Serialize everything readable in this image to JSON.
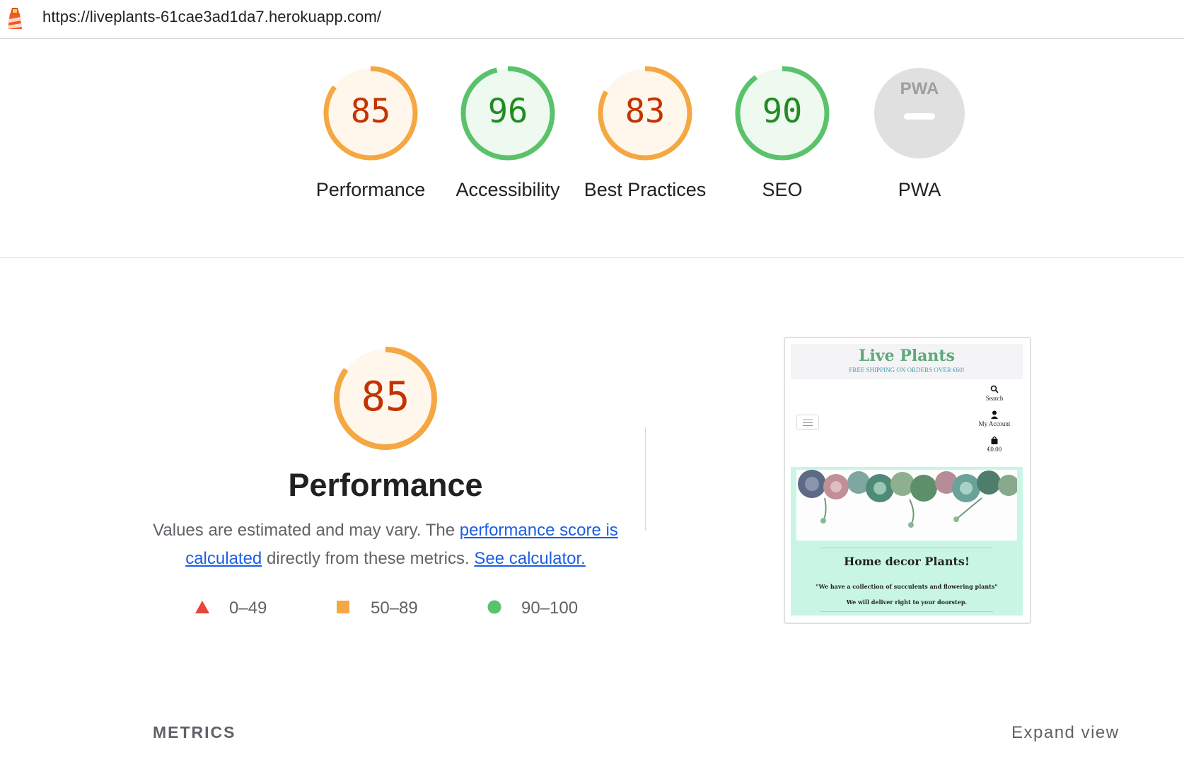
{
  "header": {
    "logo_icon": "lighthouse-icon",
    "url": "https://liveplants-61cae3ad1da7.herokuapp.com/"
  },
  "gauges": [
    {
      "score": "85",
      "value": 0.85,
      "label": "Performance",
      "rating": "average"
    },
    {
      "score": "96",
      "value": 0.96,
      "label": "Accessibility",
      "rating": "pass"
    },
    {
      "score": "83",
      "value": 0.83,
      "label": "Best Practices",
      "rating": "average"
    },
    {
      "score": "90",
      "value": 0.9,
      "label": "SEO",
      "rating": "pass"
    },
    {
      "score": "",
      "value": null,
      "label": "PWA",
      "rating": "na",
      "badge_text": "PWA"
    }
  ],
  "colors": {
    "average_stroke": "#f4a742",
    "average_text": "#c33300",
    "average_fill": "#fff6ec",
    "pass_stroke": "#5ac26b",
    "pass_text": "#228b22",
    "pass_fill": "#eef9f0",
    "fail": "#e8453c",
    "na_fill": "#e0e0e0",
    "link": "#1a5ee6"
  },
  "performance": {
    "score": "85",
    "value": 0.85,
    "title": "Performance",
    "desc_prefix": "Values are estimated and may vary. The ",
    "link_score": "performance score is calculated",
    "desc_mid": " directly from these metrics. ",
    "link_calc": "See calculator."
  },
  "legend": [
    {
      "icon": "triangle-icon",
      "range": "0–49"
    },
    {
      "icon": "square-icon",
      "range": "50–89"
    },
    {
      "icon": "circle-icon",
      "range": "90–100"
    }
  ],
  "screenshot": {
    "brand": "Live Plants",
    "shipping": "FREE SHIPPING ON ORDERS OVER €60!",
    "nav": [
      {
        "icon": "search-icon",
        "label": "Search"
      },
      {
        "icon": "user-icon",
        "label": "My Account"
      },
      {
        "icon": "bag-icon",
        "label": "€0.00"
      }
    ],
    "heading": "Home decor Plants!",
    "line1": "\"We have a collection of succulents and flowering plants\"",
    "line2": "We will deliver right to your doorstep."
  },
  "footer": {
    "metrics_label": "METRICS",
    "expand_label": "Expand view"
  }
}
